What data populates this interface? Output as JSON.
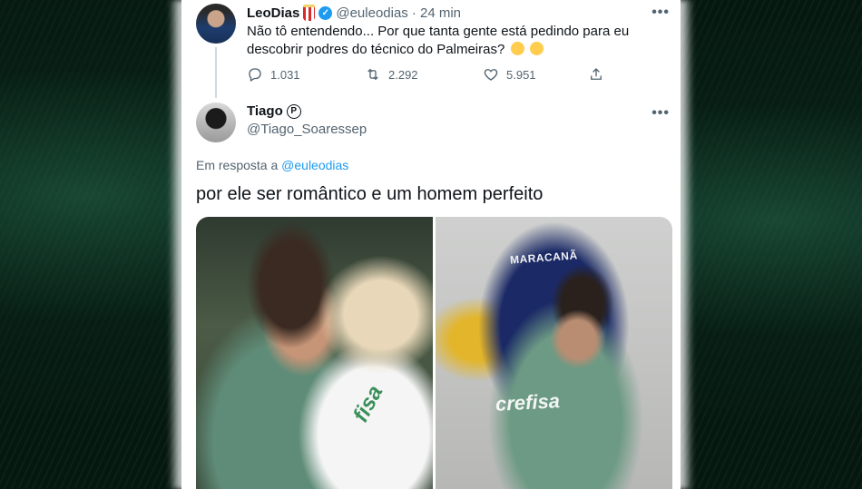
{
  "tweet": {
    "display_name": "LeoDias",
    "handle": "@euleodias",
    "time": "· 24 min",
    "text": "Não tô entendendo... Por que tanta gente está pedindo para eu descobrir podres do técnico do Palmeiras?",
    "replies": "1.031",
    "retweets": "2.292",
    "likes": "5.951",
    "more": "•••"
  },
  "reply": {
    "display_name": "Tiago",
    "badge": "P",
    "handle": "@Tiago_Soaressep",
    "in_reply_prefix": "Em resposta a",
    "in_reply_handle": "@euleodias",
    "text": "por ele ser romântico e um homem perfeito",
    "more": "•••",
    "photos": {
      "right_seat_text": "MARACANÃ",
      "left_shirt_text": "fisa",
      "right_shirt_text": "crefisa"
    }
  },
  "icons": [
    "verified-icon",
    "popcorn-icon",
    "reply-icon",
    "retweet-icon",
    "like-icon",
    "share-icon",
    "more-icon"
  ],
  "colors": {
    "accent": "#1d9bf0",
    "text": "#0f1419",
    "muted": "#536471"
  }
}
